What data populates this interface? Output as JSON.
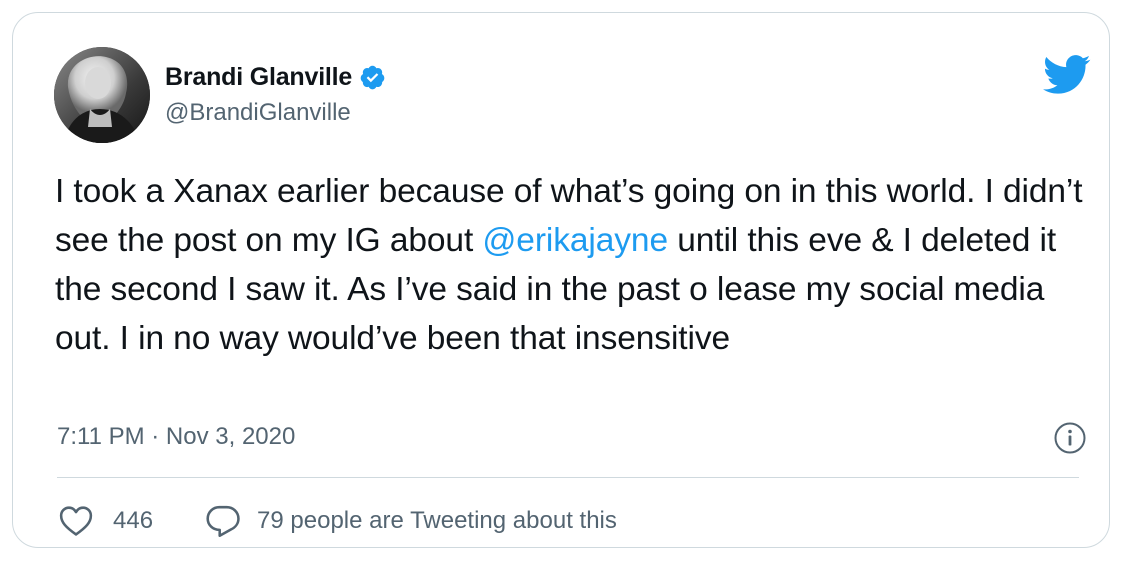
{
  "author": {
    "display_name": "Brandi Glanville",
    "handle": "@BrandiGlanville",
    "verified": true
  },
  "tweet": {
    "text_before": "I took a Xanax earlier because of what’s going on in this world. I didn’t see the post on my IG about ",
    "mention": "@erikajayne",
    "text_after": " until this eve & I deleted it the second I saw it. As I’ve said in the past o lease my social media out. I in no way would’ve been that insensitive",
    "timestamp": "7:11 PM · Nov 3, 2020"
  },
  "actions": {
    "like_count": "446",
    "reply_label": "79 people are Tweeting about this"
  },
  "icons": {
    "brand": "twitter-bird-icon",
    "verified": "verified-badge-icon",
    "info": "info-icon",
    "like": "heart-icon",
    "reply": "speech-bubble-icon"
  },
  "colors": {
    "accent": "#1d9bf0",
    "text": "#0f1419",
    "secondary": "#536471",
    "border": "#cfd9de"
  }
}
